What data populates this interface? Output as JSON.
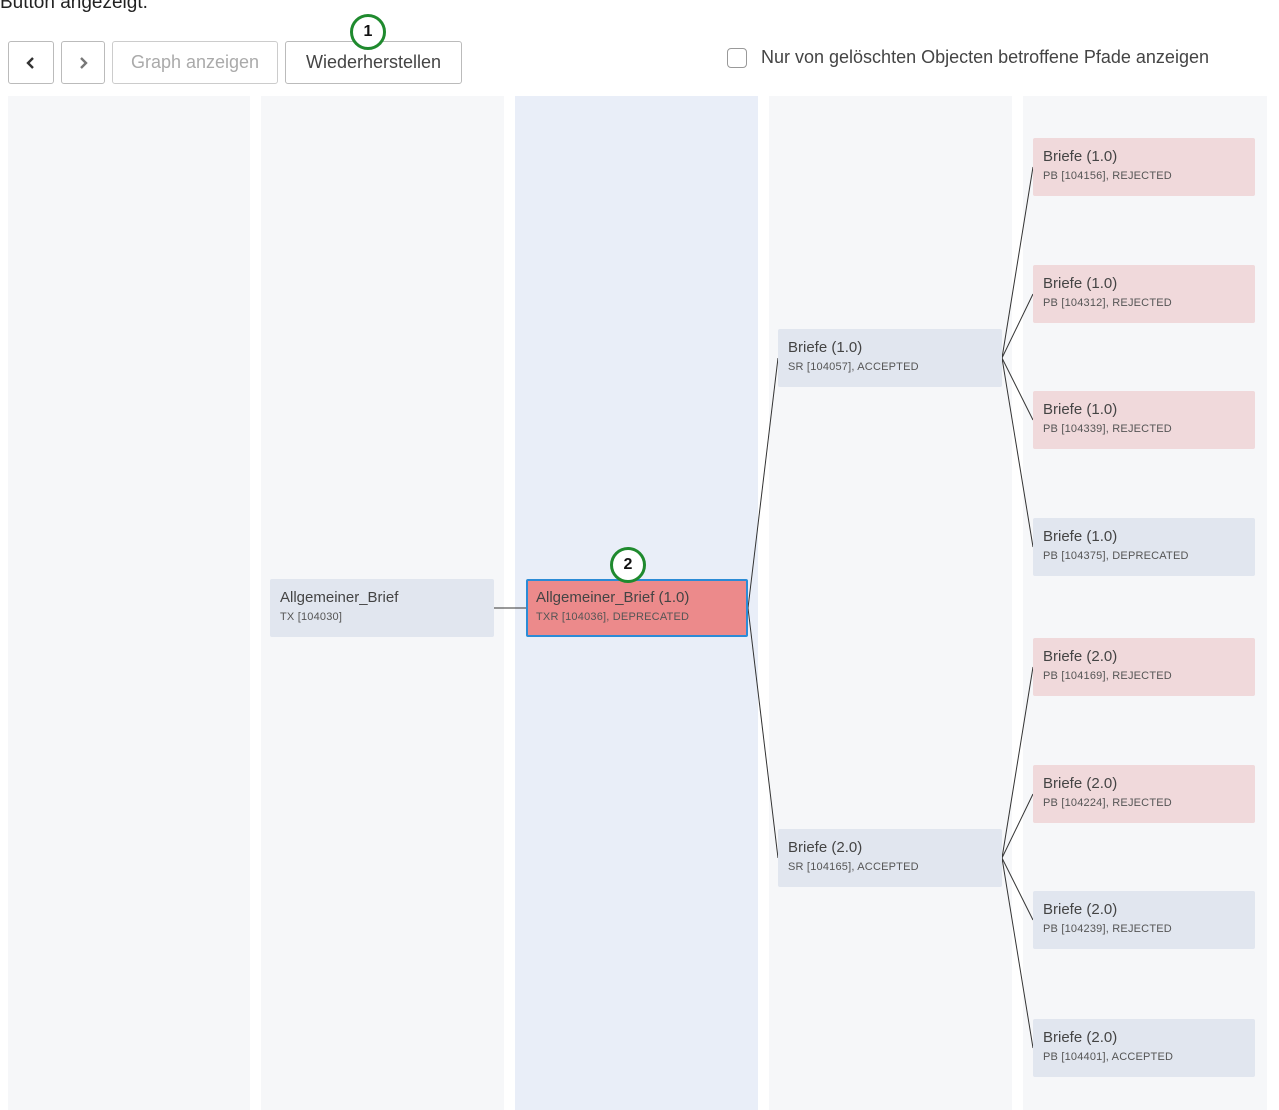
{
  "intro_text": "Button angezeigt.",
  "toolbar": {
    "back_label": "",
    "forward_label": "",
    "graph_label": "Graph anzeigen",
    "restore_label": "Wiederherstellen",
    "checkbox_label": "Nur von gelöschten Objecten betroffene Pfade anzeigen",
    "checkbox_checked": false
  },
  "markers": [
    "1",
    "2"
  ],
  "nodes": {
    "tx": {
      "title": "Allgemeiner_Brief",
      "sub": "TX [104030]"
    },
    "txr": {
      "title": "Allgemeiner_Brief (1.0)",
      "sub": "TXR [104036], DEPRECATED"
    },
    "sr1": {
      "title": "Briefe (1.0)",
      "sub": "SR [104057], ACCEPTED"
    },
    "sr2": {
      "title": "Briefe (2.0)",
      "sub": "SR [104165], ACCEPTED"
    },
    "pb": [
      {
        "title": "Briefe (1.0)",
        "sub": "PB [104156], REJECTED",
        "status": "rejected"
      },
      {
        "title": "Briefe (1.0)",
        "sub": "PB [104312], REJECTED",
        "status": "rejected"
      },
      {
        "title": "Briefe (1.0)",
        "sub": "PB [104339], REJECTED",
        "status": "rejected"
      },
      {
        "title": "Briefe (1.0)",
        "sub": "PB [104375], DEPRECATED",
        "status": "deprecated"
      },
      {
        "title": "Briefe (2.0)",
        "sub": "PB [104169], REJECTED",
        "status": "rejected"
      },
      {
        "title": "Briefe (2.0)",
        "sub": "PB [104224], REJECTED",
        "status": "rejected"
      },
      {
        "title": "Briefe (2.0)",
        "sub": "PB [104239], REJECTED",
        "status": "rejected"
      },
      {
        "title": "Briefe (2.0)",
        "sub": "PB [104401], ACCEPTED",
        "status": "accepted"
      }
    ]
  },
  "colors": {
    "selected_fill": "#ec8a8b",
    "selected_border": "#2b8bd6",
    "rejected_fill": "#f0d9db",
    "default_fill": "#e1e6ef",
    "marker_ring": "#1f8a2e"
  }
}
